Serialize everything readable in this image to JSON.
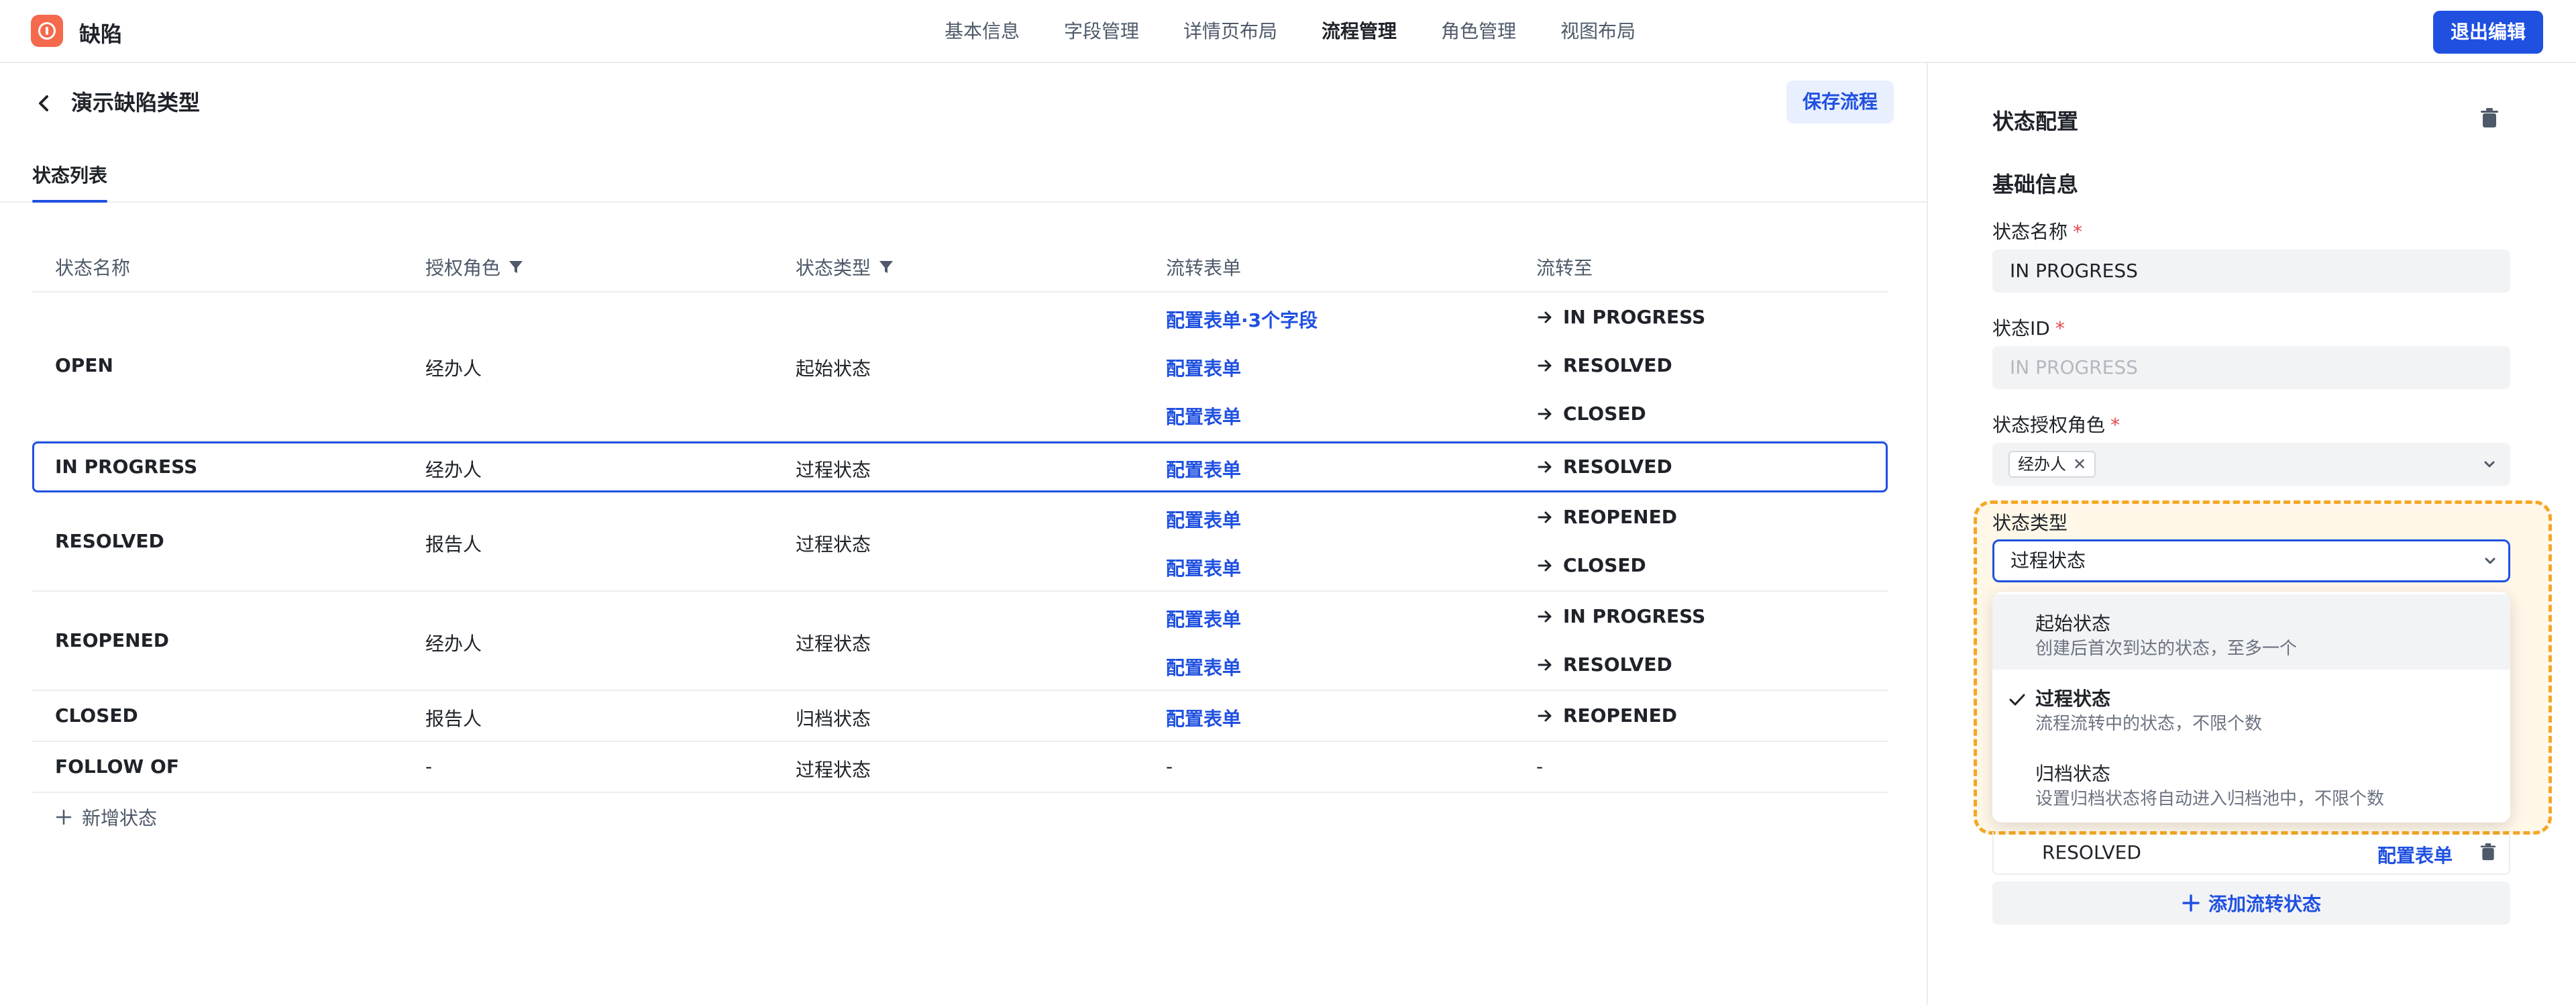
{
  "app": {
    "title": "缺陷",
    "logo_icon": "alert-circle-icon",
    "accent": "#1f50e0"
  },
  "nav": {
    "items": [
      "基本信息",
      "字段管理",
      "详情页布局",
      "流程管理",
      "角色管理",
      "视图布局"
    ],
    "active": "流程管理"
  },
  "exit_edit_label": "退出编辑",
  "page": {
    "title": "演示缺陷类型",
    "save_label": "保存流程",
    "tab": "状态列表"
  },
  "table": {
    "headers": [
      "状态名称",
      "授权角色",
      "状态类型",
      "流转表单",
      "流转至"
    ],
    "rows": [
      {
        "name": "OPEN",
        "role": "经办人",
        "type": "起始状态",
        "transitions": [
          {
            "form": "配置表单·3个字段",
            "to": "IN PROGRESS"
          },
          {
            "form": "配置表单",
            "to": "RESOLVED"
          },
          {
            "form": "配置表单",
            "to": "CLOSED"
          }
        ]
      },
      {
        "name": "IN PROGRESS",
        "role": "经办人",
        "type": "过程状态",
        "selected": true,
        "transitions": [
          {
            "form": "配置表单",
            "to": "RESOLVED"
          }
        ]
      },
      {
        "name": "RESOLVED",
        "role": "报告人",
        "type": "过程状态",
        "transitions": [
          {
            "form": "配置表单",
            "to": "REOPENED"
          },
          {
            "form": "配置表单",
            "to": "CLOSED"
          }
        ]
      },
      {
        "name": "REOPENED",
        "role": "经办人",
        "type": "过程状态",
        "transitions": [
          {
            "form": "配置表单",
            "to": "IN PROGRESS"
          },
          {
            "form": "配置表单",
            "to": "RESOLVED"
          }
        ]
      },
      {
        "name": "CLOSED",
        "role": "报告人",
        "type": "归档状态",
        "transitions": [
          {
            "form": "配置表单",
            "to": "REOPENED"
          }
        ]
      },
      {
        "name": "FOLLOW OF",
        "role": "-",
        "type": "过程状态",
        "transitions": [
          {
            "form": "-",
            "to": "-"
          }
        ]
      }
    ],
    "add_label": "新增状态"
  },
  "panel": {
    "title": "状态配置",
    "section": "基础信息",
    "name_label": "状态名称",
    "name_value": "IN PROGRESS",
    "id_label": "状态ID",
    "id_placeholder": "IN PROGRESS",
    "role_label": "状态授权角色",
    "role_tag": "经办人",
    "type_label": "状态类型",
    "type_value": "过程状态",
    "type_options": [
      {
        "title": "起始状态",
        "desc": "创建后首次到达的状态，至多一个"
      },
      {
        "title": "过程状态",
        "desc": "流程流转中的状态，不限个数",
        "selected": true
      },
      {
        "title": "归档状态",
        "desc": "设置归档状态将自动进入归档池中，不限个数"
      }
    ],
    "transition": {
      "name": "RESOLVED",
      "form": "配置表单"
    },
    "add_transition_label": "添加流转状态",
    "required_mark": "*"
  }
}
